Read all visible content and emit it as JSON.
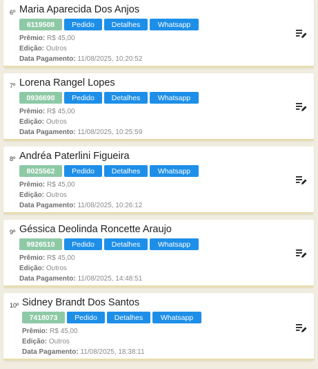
{
  "labels": {
    "pedido": "Pedido",
    "detalhes": "Detalhes",
    "whatsapp": "Whatsapp",
    "premio": "Prêmio:",
    "edicao": "Edição:",
    "data_pagamento": "Data Pagamento:"
  },
  "winners": [
    {
      "rank": "6º",
      "name": "Maria Aparecida Dos Anjos",
      "code": "6119508",
      "premio": "R$ 45,00",
      "edicao": "Outros",
      "data_pagamento": "11/08/2025, 10:20:52"
    },
    {
      "rank": "7º",
      "name": "Lorena Rangel Lopes",
      "code": "0936690",
      "premio": "R$ 45,00",
      "edicao": "Outros",
      "data_pagamento": "11/08/2025, 10:25:59"
    },
    {
      "rank": "8º",
      "name": "Andréa Paterlini Figueira",
      "code": "8025562",
      "premio": "R$ 45,00",
      "edicao": "Outros",
      "data_pagamento": "11/08/2025, 10:26:12"
    },
    {
      "rank": "9º",
      "name": "Géssica Deolinda Roncette Araujo",
      "code": "9926510",
      "premio": "R$ 45,00",
      "edicao": "Outros",
      "data_pagamento": "11/08/2025, 14:48:51"
    },
    {
      "rank": "10º",
      "name": "Sidney Brandt Dos Santos",
      "code": "7418073",
      "premio": "R$ 45,00",
      "edicao": "Outros",
      "data_pagamento": "11/08/2025, 18:38:11"
    }
  ],
  "colors": {
    "button": "#1e8fe8",
    "code_badge": "#8ec9a6",
    "card_border": "#e8dcb0"
  },
  "icons": {
    "edit": "playlist-edit-icon"
  }
}
